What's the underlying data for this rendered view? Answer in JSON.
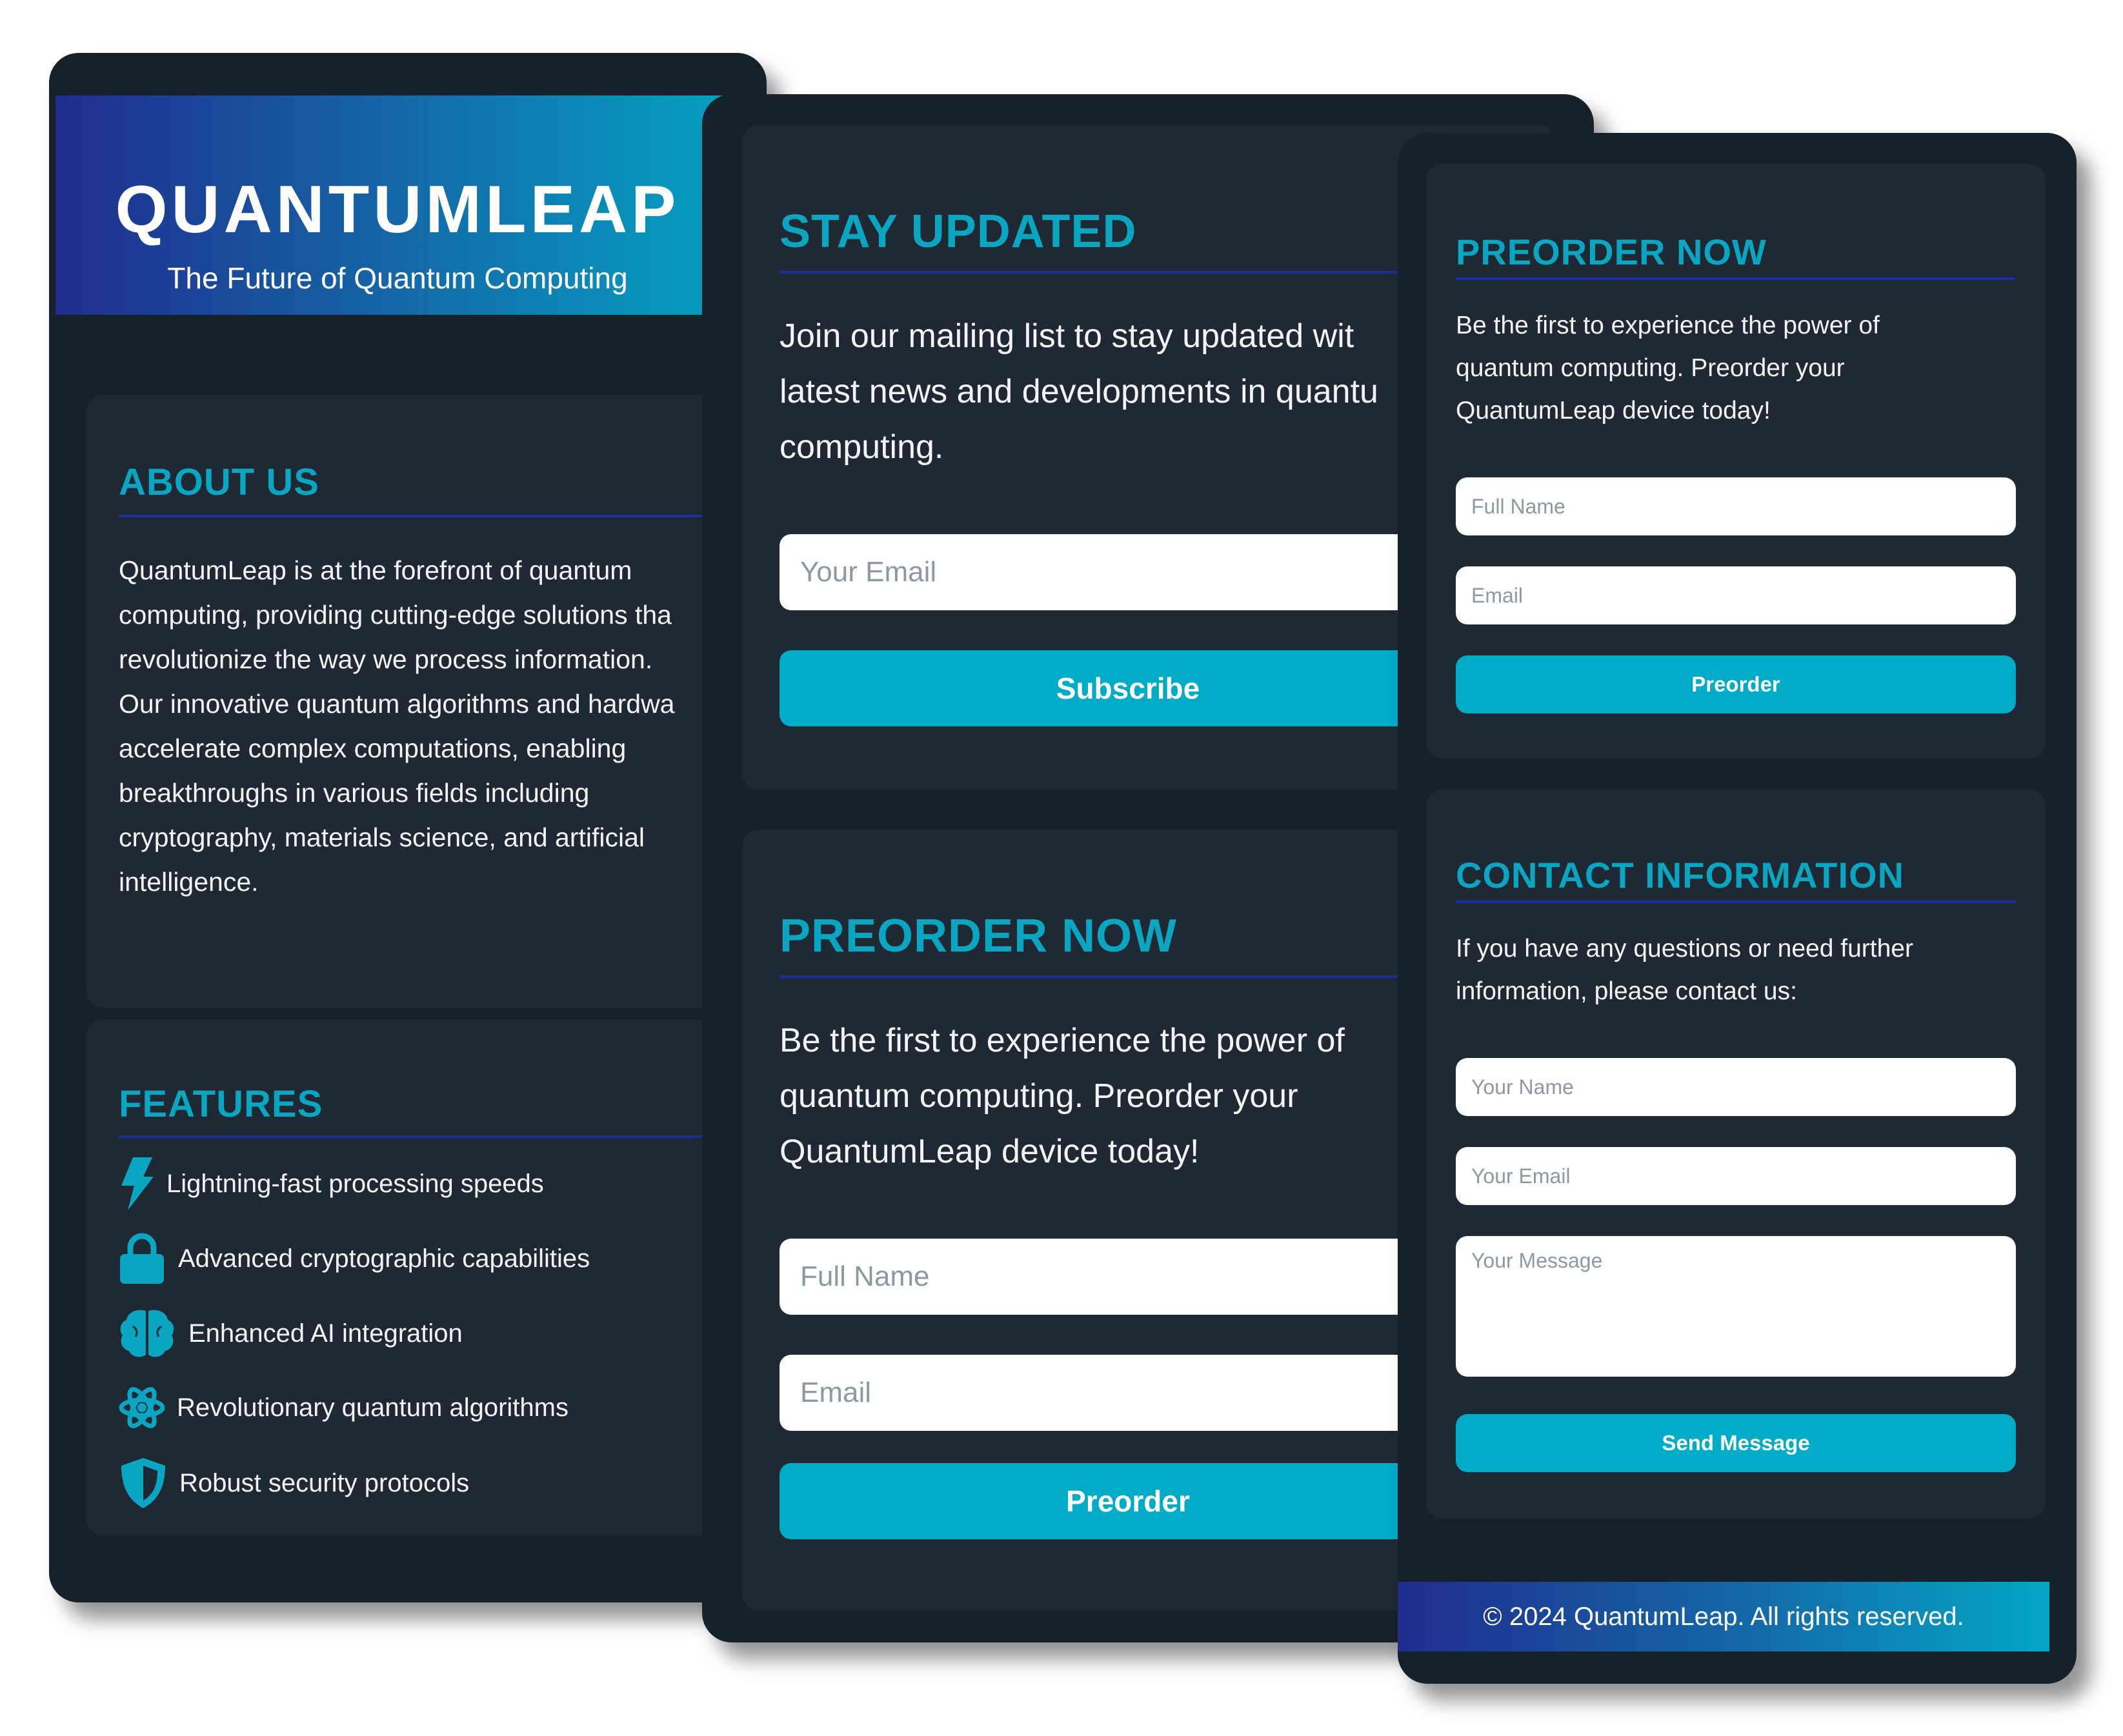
{
  "colors": {
    "accent": "#0aa6c1",
    "button": "#00abc5",
    "window_bg": "#16212b",
    "card_bg": "#1e2934",
    "rule": "#1f2f9a",
    "gradient_start": "#1f2d8d",
    "gradient_end": "#02a7c3"
  },
  "about_page": {
    "brand": "QUANTUMLEAP",
    "tagline": "The Future of Quantum Computing",
    "about": {
      "title": "ABOUT US",
      "lines": [
        "QuantumLeap is at the forefront of quantum",
        "computing, providing cutting-edge solutions tha",
        "revolutionize the way we process information.",
        "Our innovative quantum algorithms and hardwa",
        "accelerate complex computations, enabling",
        "breakthroughs in various fields including",
        "cryptography, materials science, and artificial",
        "intelligence."
      ]
    },
    "features": {
      "title": "FEATURES",
      "items": [
        {
          "icon": "lightning-bolt-icon",
          "label": "Lightning-fast processing speeds"
        },
        {
          "icon": "lock-icon",
          "label": "Advanced cryptographic capabilities"
        },
        {
          "icon": "brain-icon",
          "label": "Enhanced AI integration"
        },
        {
          "icon": "atom-icon",
          "label": "Revolutionary quantum algorithms"
        },
        {
          "icon": "shield-icon",
          "label": "Robust security protocols"
        }
      ]
    }
  },
  "signup_page": {
    "newsletter": {
      "title": "STAY UPDATED",
      "lines": [
        "Join our mailing list to stay updated wit",
        "latest news and developments in quantu",
        "computing."
      ],
      "email_placeholder": "Your Email",
      "button": "Subscribe"
    },
    "preorder": {
      "title": "PREORDER NOW",
      "lines": [
        "Be the first to experience the power of",
        "quantum computing. Preorder your",
        "QuantumLeap device today!"
      ],
      "name_placeholder": "Full Name",
      "email_placeholder": "Email",
      "button": "Preorder"
    }
  },
  "contact_page": {
    "preorder": {
      "title": "PREORDER NOW",
      "lines": [
        "Be the first to experience the power of",
        "quantum computing. Preorder your",
        "QuantumLeap device today!"
      ],
      "name_placeholder": "Full Name",
      "email_placeholder": "Email",
      "button": "Preorder"
    },
    "contact": {
      "title": "CONTACT INFORMATION",
      "lines": [
        "If you have any questions or need further",
        "information, please contact us:"
      ],
      "name_placeholder": "Your Name",
      "email_placeholder": "Your Email",
      "message_placeholder": "Your Message",
      "button": "Send Message"
    },
    "footer": "© 2024 QuantumLeap. All rights reserved."
  }
}
